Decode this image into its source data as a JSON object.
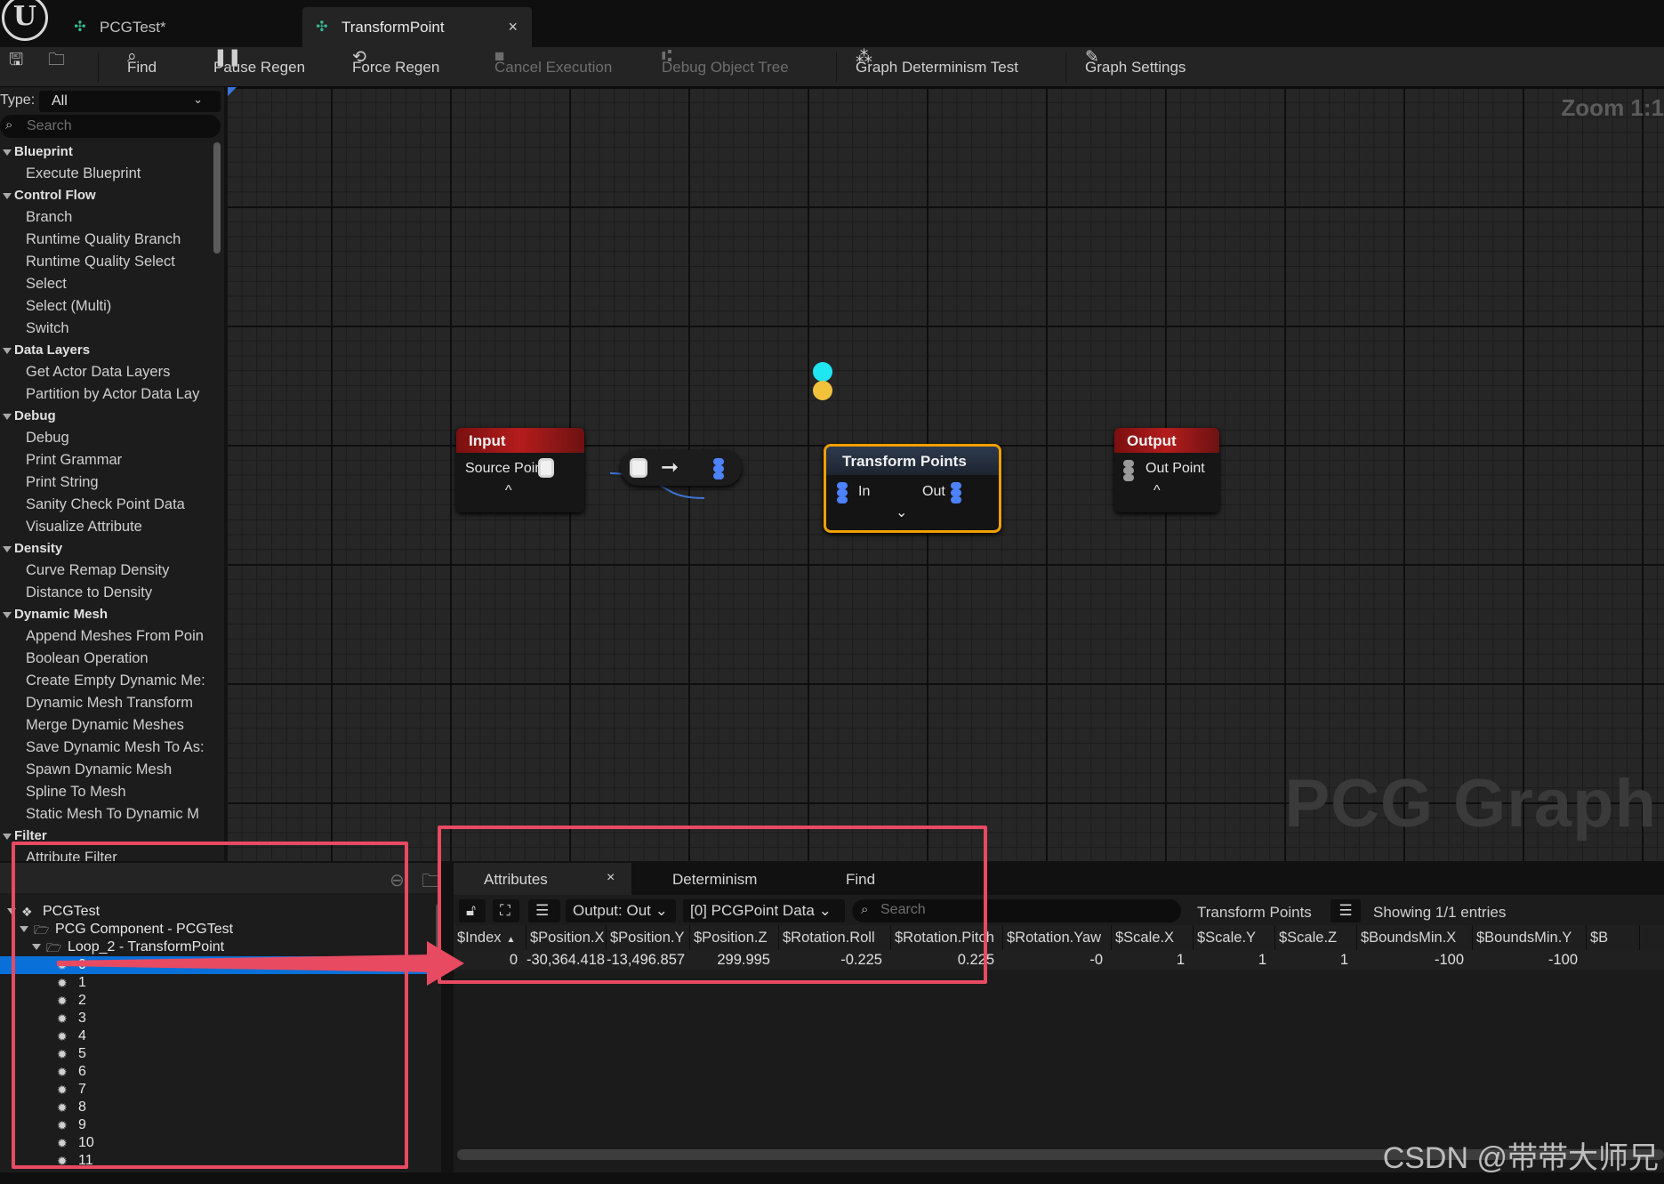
{
  "tabs": [
    {
      "label": "PCGTest*"
    },
    {
      "label": "TransformPoint",
      "close": "×"
    }
  ],
  "logo_text": "U",
  "toolbar": {
    "find": "Find",
    "pause_regen": "Pause Regen",
    "force_regen": "Force Regen",
    "cancel_execution": "Cancel Execution",
    "debug_object_tree": "Debug Object Tree",
    "determinism_test": "Graph Determinism Test",
    "graph_settings": "Graph Settings"
  },
  "palette": {
    "type_label": "Type:",
    "type_value": "All",
    "search_placeholder": "Search",
    "entries": [
      {
        "kind": "category",
        "label": "Blueprint"
      },
      {
        "kind": "item",
        "label": "Execute Blueprint"
      },
      {
        "kind": "category",
        "label": "Control Flow"
      },
      {
        "kind": "item",
        "label": "Branch"
      },
      {
        "kind": "item",
        "label": "Runtime Quality Branch"
      },
      {
        "kind": "item",
        "label": "Runtime Quality Select"
      },
      {
        "kind": "item",
        "label": "Select"
      },
      {
        "kind": "item",
        "label": "Select (Multi)"
      },
      {
        "kind": "item",
        "label": "Switch"
      },
      {
        "kind": "category",
        "label": "Data Layers"
      },
      {
        "kind": "item",
        "label": "Get Actor Data Layers"
      },
      {
        "kind": "item",
        "label": "Partition by Actor Data Lay"
      },
      {
        "kind": "category",
        "label": "Debug"
      },
      {
        "kind": "item",
        "label": "Debug"
      },
      {
        "kind": "item",
        "label": "Print Grammar"
      },
      {
        "kind": "item",
        "label": "Print String"
      },
      {
        "kind": "item",
        "label": "Sanity Check Point Data"
      },
      {
        "kind": "item",
        "label": "Visualize Attribute"
      },
      {
        "kind": "category",
        "label": "Density"
      },
      {
        "kind": "item",
        "label": "Curve Remap Density"
      },
      {
        "kind": "item",
        "label": "Distance to Density"
      },
      {
        "kind": "category",
        "label": "Dynamic Mesh"
      },
      {
        "kind": "item",
        "label": "Append Meshes From Poin"
      },
      {
        "kind": "item",
        "label": "Boolean Operation"
      },
      {
        "kind": "item",
        "label": "Create Empty Dynamic Me:"
      },
      {
        "kind": "item",
        "label": "Dynamic Mesh Transform"
      },
      {
        "kind": "item",
        "label": "Merge Dynamic Meshes"
      },
      {
        "kind": "item",
        "label": "Save Dynamic Mesh To As:"
      },
      {
        "kind": "item",
        "label": "Spawn Dynamic Mesh"
      },
      {
        "kind": "item",
        "label": "Spline To Mesh"
      },
      {
        "kind": "item",
        "label": "Static Mesh To Dynamic M"
      },
      {
        "kind": "category",
        "label": "Filter"
      },
      {
        "kind": "item",
        "label": "Attribute Filter"
      }
    ]
  },
  "graph": {
    "zoom": "Zoom 1:1",
    "watermark": "PCG Graph",
    "nodes": {
      "input": {
        "title": "Input",
        "pin": "Source Point",
        "chevron": "^"
      },
      "transform": {
        "title": "Transform Points",
        "in": "In",
        "out": "Out",
        "chevron": "⌄"
      },
      "output": {
        "title": "Output",
        "pin": "Out Point",
        "chevron": "^"
      }
    }
  },
  "debug_tree": {
    "rows": [
      {
        "label": "PCGTest",
        "depth": 0,
        "expanded": true,
        "icon": "actor-icon"
      },
      {
        "label": "PCG Component - PCGTest",
        "depth": 1,
        "expanded": true,
        "icon": "folder-icon"
      },
      {
        "label": "Loop_2 - TransformPoint",
        "depth": 2,
        "expanded": true,
        "icon": "folder-icon"
      },
      {
        "label": "0",
        "depth": 3,
        "selected": true,
        "icon": "bug-icon"
      },
      {
        "label": "1",
        "depth": 3,
        "icon": "bug-icon"
      },
      {
        "label": "2",
        "depth": 3,
        "icon": "bug-icon"
      },
      {
        "label": "3",
        "depth": 3,
        "icon": "bug-icon"
      },
      {
        "label": "4",
        "depth": 3,
        "icon": "bug-icon"
      },
      {
        "label": "5",
        "depth": 3,
        "icon": "bug-icon"
      },
      {
        "label": "6",
        "depth": 3,
        "icon": "bug-icon"
      },
      {
        "label": "7",
        "depth": 3,
        "icon": "bug-icon"
      },
      {
        "label": "8",
        "depth": 3,
        "icon": "bug-icon"
      },
      {
        "label": "9",
        "depth": 3,
        "icon": "bug-icon"
      },
      {
        "label": "10",
        "depth": 3,
        "icon": "bug-icon"
      },
      {
        "label": "11",
        "depth": 3,
        "icon": "bug-icon"
      }
    ]
  },
  "attributes": {
    "tabs": [
      "Attributes",
      "Determinism",
      "Find"
    ],
    "tab_close": "×",
    "output_select": "Output: Out",
    "data_select": "[0] PCGPoint Data",
    "search_placeholder": "Search",
    "node_name": "Transform Points",
    "showing": "Showing 1/1 entries",
    "sort_indicator": "▲",
    "columns": [
      "$Index",
      "$Position.X",
      "$Position.Y",
      "$Position.Z",
      "$Rotation.Roll",
      "$Rotation.Pitch",
      "$Rotation.Yaw",
      "$Scale.X",
      "$Scale.Y",
      "$Scale.Z",
      "$BoundsMin.X",
      "$BoundsMin.Y",
      "$B"
    ],
    "row": [
      "0",
      "-30,364.418",
      "-13,496.857",
      "299.995",
      "-0.225",
      "0.225",
      "-0",
      "1",
      "1",
      "1",
      "-100",
      "-100"
    ]
  },
  "colors": {
    "highlight": "#e84a62",
    "selection": "#0a70d9",
    "node_selected_border": "#f0a000",
    "wire": "#3f74d4",
    "exec_cyan": "#1fe6f0",
    "exec_yellow": "#f2c23c"
  },
  "corner_watermark": "CSDN @带带大师兄"
}
